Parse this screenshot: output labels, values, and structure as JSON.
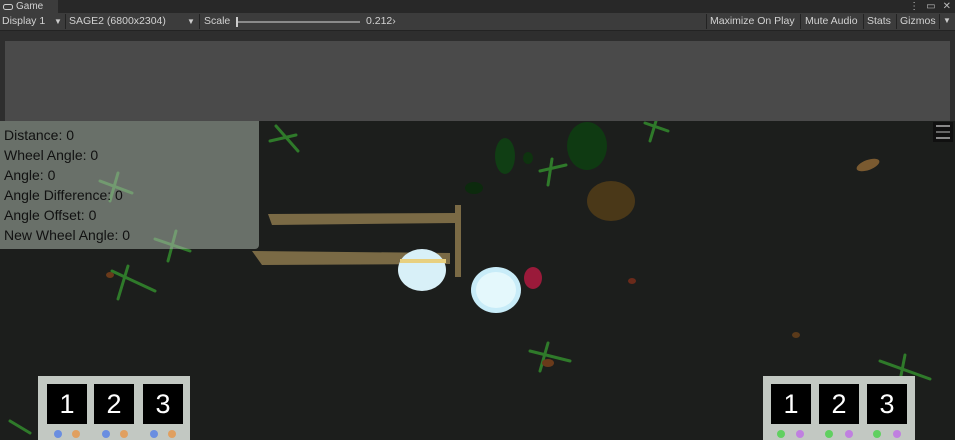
{
  "window": {
    "tab_title": "Game"
  },
  "toolbar": {
    "display": "Display 1",
    "resolution": "SAGE2 (6800x2304)",
    "scale_label": "Scale",
    "scale_value": "0.212",
    "maximize_on_play": "Maximize On Play",
    "mute_audio": "Mute Audio",
    "stats": "Stats",
    "gizmos": "Gizmos"
  },
  "info_panel": {
    "lines": [
      "Distance: 0",
      "Wheel Angle: 0",
      "Angle: 0",
      "Angle Difference: 0",
      "Angle Offset: 0",
      "New Wheel Angle: 0"
    ]
  },
  "hud_left": {
    "slots": [
      "1",
      "2",
      "3"
    ],
    "dot_colors": [
      "#6a8ee0",
      "#e0a060"
    ]
  },
  "hud_right": {
    "slots": [
      "1",
      "2",
      "3"
    ],
    "dot_colors": [
      "#60d060",
      "#c080e0"
    ]
  },
  "icons": {
    "tab": "gamepad-icon",
    "window": [
      "more-options-icon",
      "maximize-icon",
      "close-icon"
    ],
    "gizmos_menu": "chevron-down-icon"
  }
}
